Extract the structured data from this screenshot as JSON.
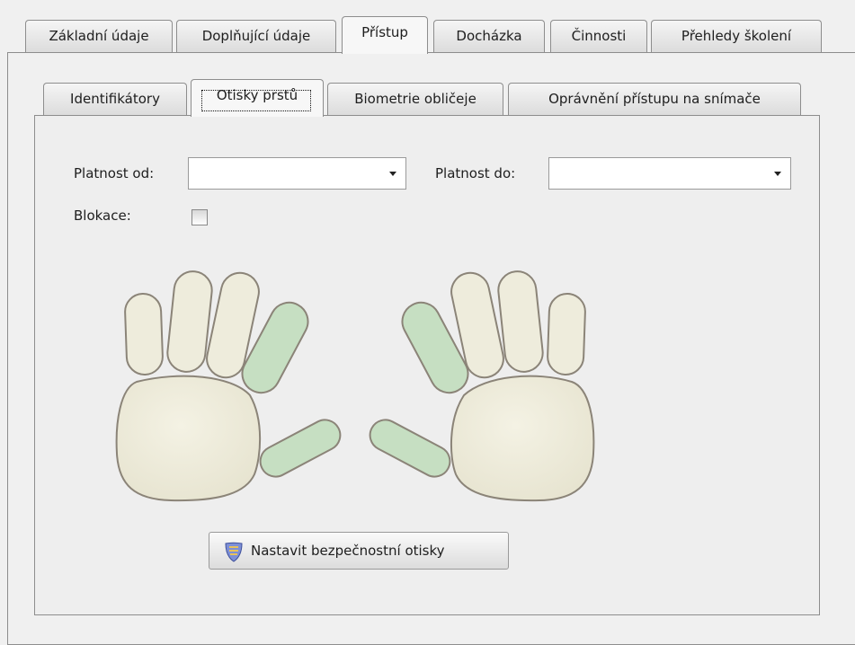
{
  "outer_tabs": [
    {
      "label": "Základní údaje",
      "active": false
    },
    {
      "label": "Doplňující údaje",
      "active": false
    },
    {
      "label": "Přístup",
      "active": true
    },
    {
      "label": "Docházka",
      "active": false
    },
    {
      "label": "Činnosti",
      "active": false
    },
    {
      "label": "Přehledy školení",
      "active": false
    }
  ],
  "inner_tabs": [
    {
      "label": "Identifikátory",
      "active": false
    },
    {
      "label": "Otisky prstů",
      "active": true
    },
    {
      "label": "Biometrie obličeje",
      "active": false
    },
    {
      "label": "Oprávnění přístupu na snímače",
      "active": false
    }
  ],
  "form": {
    "valid_from_label": "Platnost od:",
    "valid_from_value": "",
    "valid_to_label": "Platnost do:",
    "valid_to_value": "",
    "blocking_label": "Blokace:",
    "blocking_checked": false
  },
  "fingers": {
    "left_hand": {
      "little": "not-enrolled",
      "ring": "not-enrolled",
      "middle": "not-enrolled",
      "index": "enrolled",
      "thumb": "enrolled"
    },
    "right_hand": {
      "thumb": "enrolled",
      "index": "enrolled",
      "middle": "not-enrolled",
      "ring": "not-enrolled",
      "little": "not-enrolled"
    }
  },
  "set_secure_prints_button": "Nastavit bezpečnostní otisky",
  "colors": {
    "enrolled_finger": "#c6dfc2",
    "not_enrolled_finger": "#eeecdc",
    "outline": "#8b8478"
  }
}
